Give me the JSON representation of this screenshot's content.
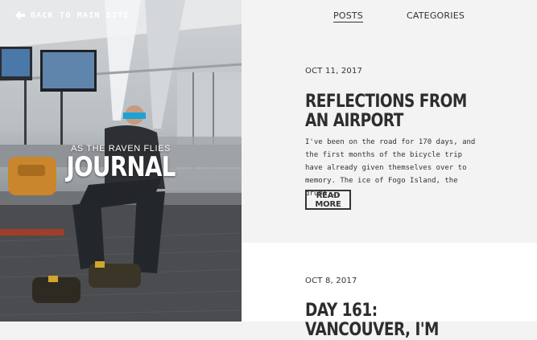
{
  "hero": {
    "back_link": {
      "label": "BACK TO MAIN SITE",
      "icon": "arrow-left-icon"
    },
    "subtitle": "AS THE RAVEN FLIES",
    "title": "JOURNAL"
  },
  "nav": {
    "items": [
      {
        "label": "POSTS",
        "active": true
      },
      {
        "label": "CATEGORIES",
        "active": false
      }
    ]
  },
  "posts": [
    {
      "date": "OCT 11, 2017",
      "title": "REFLECTIONS FROM AN AIRPORT",
      "excerpt": "I've been on the road for 170 days, and the first months of the bicycle trip have already given themselves over to memory. The ice of Fogo Island, the drums...",
      "read_more": "READ MORE"
    },
    {
      "date": "OCT 8, 2017",
      "title": "DAY 161: VANCOUVER, I'M"
    }
  ],
  "colors": {
    "text_dark": "#2d2d2d",
    "panel_light": "#f3f3f3",
    "panel_white": "#ffffff"
  }
}
